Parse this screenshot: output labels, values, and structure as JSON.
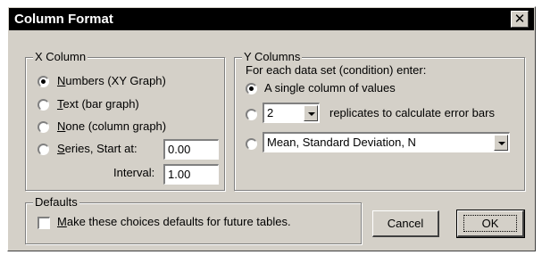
{
  "window": {
    "title": "Column Format",
    "close_glyph": "✕"
  },
  "x_column": {
    "group_label": "X Column",
    "options": [
      {
        "mnemonic": "N",
        "rest": "umbers (XY Graph)",
        "checked": true
      },
      {
        "mnemonic": "T",
        "rest": "ext (bar graph)",
        "checked": false
      },
      {
        "mnemonic": "N",
        "rest": "one (column graph)",
        "checked": false
      },
      {
        "mnemonic": "S",
        "rest": "eries, Start at:",
        "checked": false
      }
    ],
    "start_value": "0.00",
    "interval_label": "Interval:",
    "interval_value": "1.00"
  },
  "y_columns": {
    "group_label": "Y Columns",
    "instruction": "For each data set (condition) enter:",
    "single_option": "A single column of values",
    "replicates_value": "2",
    "replicates_text": "replicates to calculate error bars",
    "summary_value": "Mean, Standard Deviation, N",
    "selected_index": 0
  },
  "defaults": {
    "group_label": "Defaults",
    "checkbox_mnemonic": "M",
    "checkbox_rest": "ake these choices defaults for future tables.",
    "checked": false
  },
  "buttons": {
    "cancel": "Cancel",
    "ok": "OK"
  },
  "colors": {
    "dialog_face": "#d4d0c8",
    "titlebar": "#000000",
    "title_text": "#ffffff"
  },
  "icons": {
    "close": "close-icon",
    "dropdown": "chevron-down-icon"
  }
}
